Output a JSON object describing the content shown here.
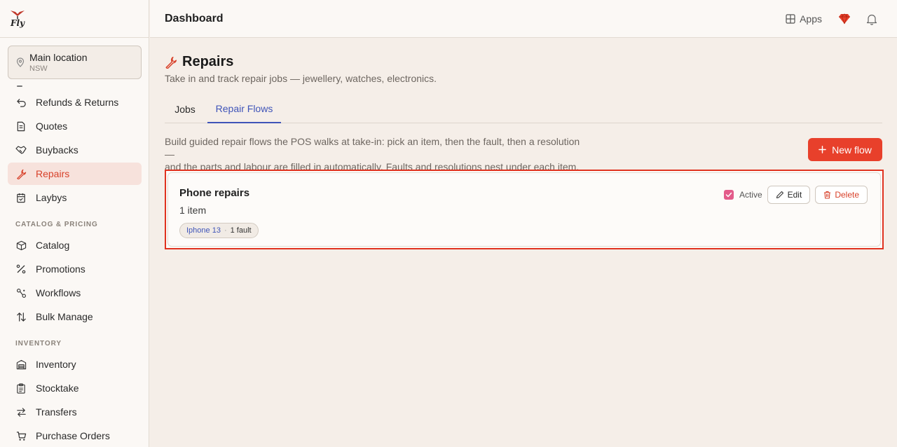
{
  "app": {
    "logo_text": "Fly",
    "header_title": "Dashboard",
    "apps_label": "Apps"
  },
  "location": {
    "name": "Main location",
    "state": "NSW"
  },
  "sidebar": {
    "items_top": [
      {
        "label": "Refunds & Returns",
        "icon": "undo-icon"
      },
      {
        "label": "Quotes",
        "icon": "document-icon"
      },
      {
        "label": "Buybacks",
        "icon": "handshake-icon"
      },
      {
        "label": "Repairs",
        "icon": "wrench-icon",
        "active": true
      },
      {
        "label": "Laybys",
        "icon": "calendar-icon"
      }
    ],
    "section_catalog": "CATALOG & PRICING",
    "items_catalog": [
      {
        "label": "Catalog",
        "icon": "box-icon"
      },
      {
        "label": "Promotions",
        "icon": "percent-icon"
      },
      {
        "label": "Workflows",
        "icon": "workflow-icon"
      },
      {
        "label": "Bulk Manage",
        "icon": "sort-arrows-icon"
      }
    ],
    "section_inventory": "INVENTORY",
    "items_inventory": [
      {
        "label": "Inventory",
        "icon": "warehouse-icon"
      },
      {
        "label": "Stocktake",
        "icon": "clipboard-icon"
      },
      {
        "label": "Transfers",
        "icon": "transfer-icon"
      },
      {
        "label": "Purchase Orders",
        "icon": "cart-icon"
      }
    ]
  },
  "page": {
    "title": "Repairs",
    "subtitle": "Take in and track repair jobs — jewellery, watches, electronics.",
    "tabs": [
      {
        "label": "Jobs",
        "active": false
      },
      {
        "label": "Repair Flows",
        "active": true
      }
    ],
    "description_line1": "Build guided repair flows the POS walks at take-in: pick an item, then the fault, then a resolution —",
    "description_line2": "and the parts and labour are filled in automatically. Faults and resolutions nest under each item.",
    "new_flow_label": "New flow"
  },
  "flows": [
    {
      "title": "Phone repairs",
      "count": "1 item",
      "chip_item": "Iphone 13",
      "chip_sep": "·",
      "chip_fault": "1 fault",
      "active": true,
      "active_label": "Active",
      "edit_label": "Edit",
      "delete_label": "Delete"
    }
  ],
  "colors": {
    "accent": "#e8402b",
    "tab_active": "#3f54b8",
    "checkbox": "#e35b8a",
    "background": "#f5eee8"
  }
}
